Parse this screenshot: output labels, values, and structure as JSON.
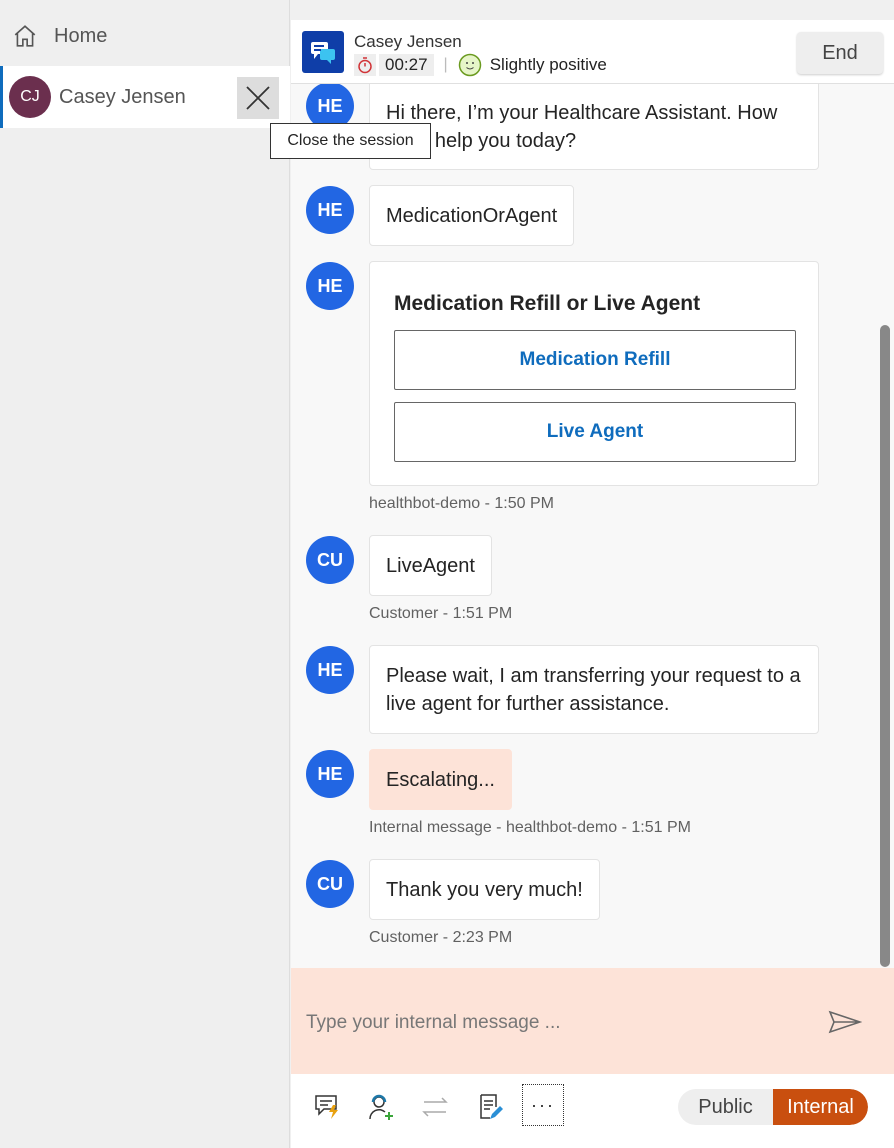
{
  "sidebar": {
    "home_label": "Home",
    "session": {
      "initials": "CJ",
      "name": "Casey Jensen"
    },
    "close_tooltip": "Close the session"
  },
  "header": {
    "name": "Casey Jensen",
    "timer": "00:27",
    "sentiment": "Slightly positive",
    "end_label": "End"
  },
  "messages": [
    {
      "avatar": "HE",
      "text": "Hi there, I’m your Healthcare Assistant. How can I help you today?"
    },
    {
      "avatar": "HE",
      "text": "MedicationOrAgent"
    },
    {
      "avatar": "HE",
      "card": {
        "title": "Medication Refill or Live Agent",
        "buttons": [
          "Medication Refill",
          "Live Agent"
        ]
      },
      "meta": "healthbot-demo - 1:50 PM"
    },
    {
      "avatar": "CU",
      "text": "LiveAgent",
      "meta": "Customer - 1:51 PM"
    },
    {
      "avatar": "HE",
      "text": "Please wait, I am transferring your request to a live agent for further assistance."
    },
    {
      "avatar": "HE",
      "text": "Escalating...",
      "meta": "Internal message - healthbot-demo - 1:51 PM"
    },
    {
      "avatar": "CU",
      "text": "Thank you very much!",
      "meta": "Customer - 2:23 PM"
    }
  ],
  "composer": {
    "placeholder": "Type your internal message ..."
  },
  "toolbar": {
    "public_label": "Public",
    "internal_label": "Internal"
  },
  "colors": {
    "accent": "#0f6cbd",
    "avatar": "#2266e3",
    "internal": "#c94f0f",
    "internal_bg": "#fde3d8"
  }
}
